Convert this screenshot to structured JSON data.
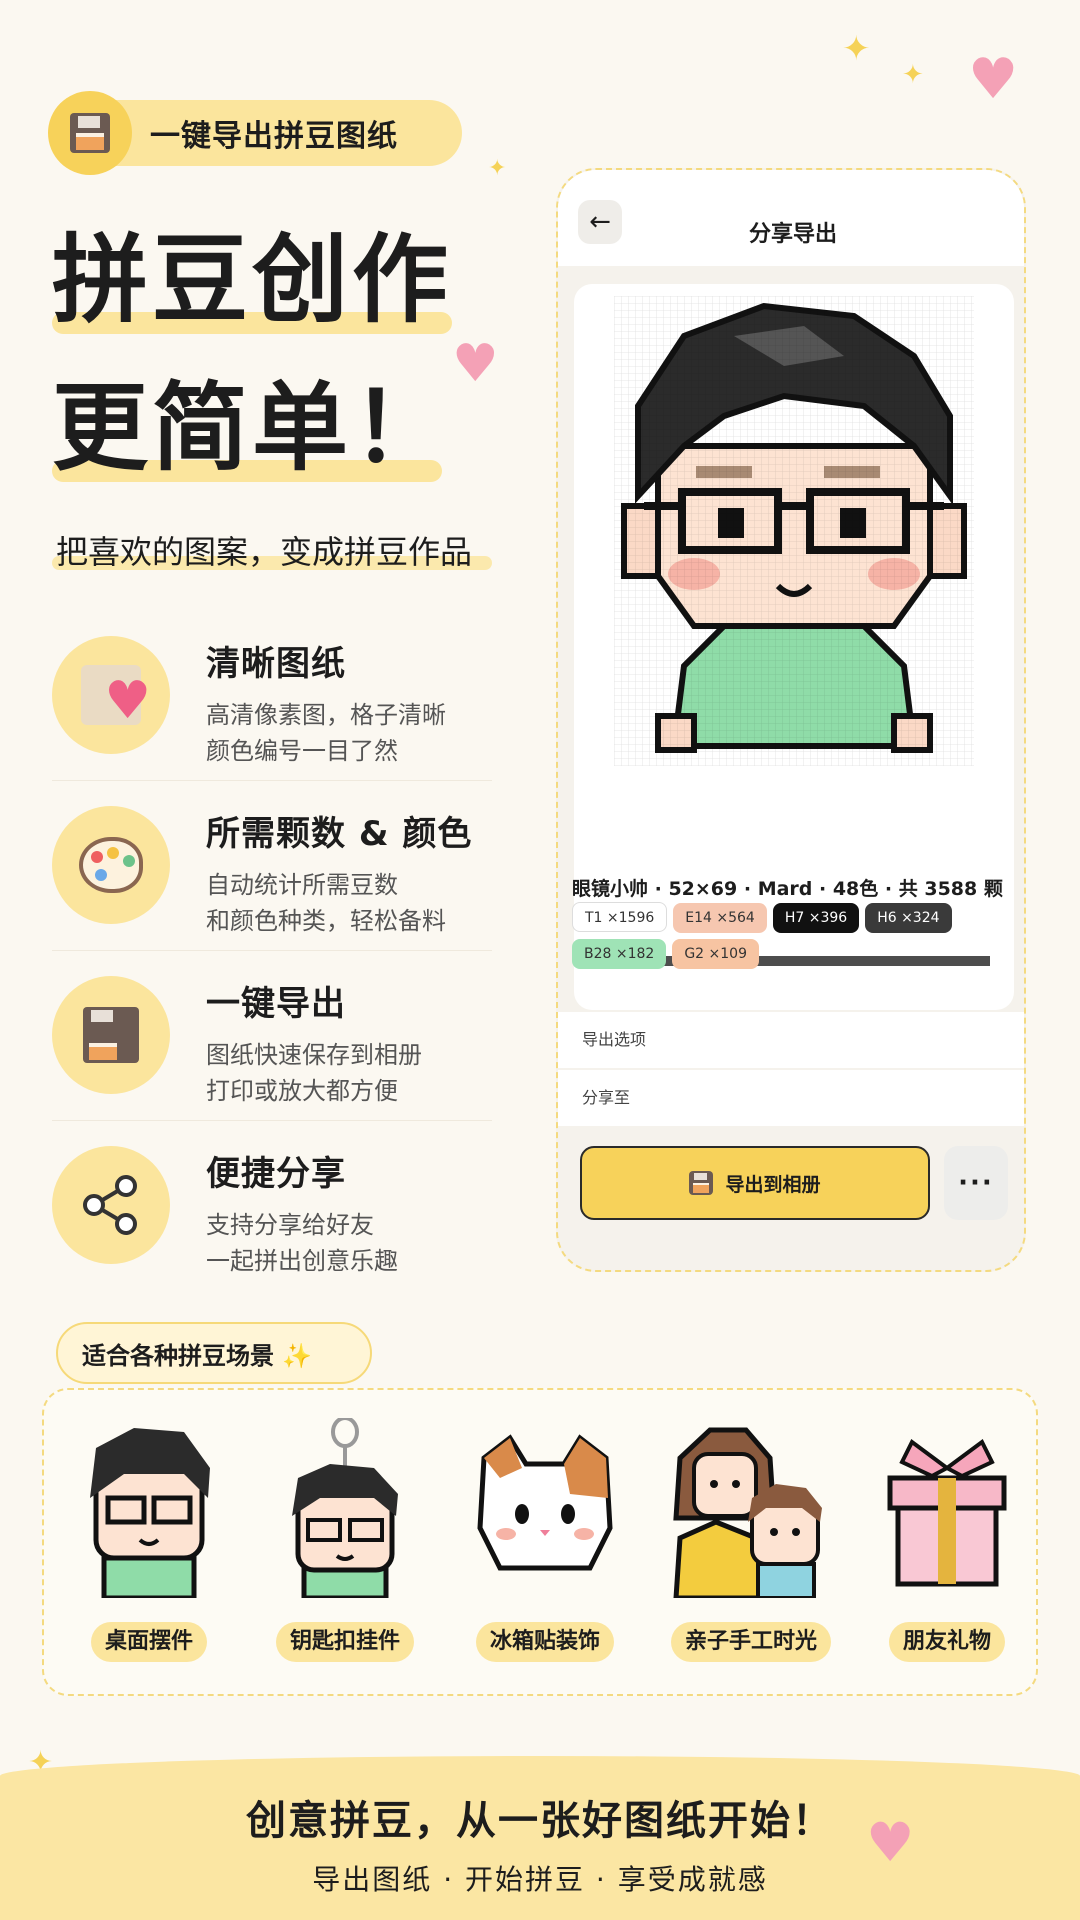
{
  "header": {
    "badge_label": "一键导出拼豆图纸",
    "icon": "floppy-disk-icon"
  },
  "hero": {
    "line1": "拼豆创作",
    "line2": "更简单！",
    "subtitle": "把喜欢的图案，变成拼豆作品"
  },
  "features": [
    {
      "title": "清晰图纸",
      "desc1": "高清像素图，格子清晰",
      "desc2": "颜色编号一目了然",
      "icon": "pixel-heart-paper-icon"
    },
    {
      "title": "所需颗数 & 颜色",
      "desc1": "自动统计所需豆数",
      "desc2": "和颜色种类，轻松备料",
      "icon": "palette-icon"
    },
    {
      "title": "一键导出",
      "desc1": "图纸快速保存到相册",
      "desc2": "打印或放大都方便",
      "icon": "floppy-disk-icon"
    },
    {
      "title": "便捷分享",
      "desc1": "支持分享给好友",
      "desc2": "一起拼出创意乐趣",
      "icon": "share-icon"
    }
  ],
  "phone": {
    "back_glyph": "←",
    "title": "分享导出",
    "meta": "眼镜小帅 · 52×69 · Mard · 48色 · 共 3588 颗",
    "chips": [
      {
        "label": "T1 ×1596",
        "bg": "#ffffff",
        "fg": "#333333"
      },
      {
        "label": "E14 ×564",
        "bg": "#f6c7b0",
        "fg": "#333333"
      },
      {
        "label": "H7 ×396",
        "bg": "#111111",
        "fg": "#ffffff"
      },
      {
        "label": "H6 ×324",
        "bg": "#3a3a3a",
        "fg": "#ffffff"
      },
      {
        "label": "B28 ×182",
        "bg": "#9fe3b6",
        "fg": "#333333"
      },
      {
        "label": "G2 ×109",
        "bg": "#f7c4a2",
        "fg": "#333333"
      }
    ],
    "export_options_label": "导出选项",
    "share_to_label": "分享至",
    "export_button": "导出到相册",
    "more_button": "···"
  },
  "scenarios": {
    "tag": "适合各种拼豆场景 ✨",
    "items": [
      {
        "label": "桌面摆件",
        "icon": "boy-avatar-icon"
      },
      {
        "label": "钥匙扣挂件",
        "icon": "keychain-boy-icon"
      },
      {
        "label": "冰箱贴装饰",
        "icon": "cat-icon"
      },
      {
        "label": "亲子手工时光",
        "icon": "mother-child-icon"
      },
      {
        "label": "朋友礼物",
        "icon": "gift-box-icon"
      }
    ]
  },
  "footer": {
    "title": "创意拼豆，从一张好图纸开始！",
    "subtitle": "导出图纸 · 开始拼豆 · 享受成就感"
  },
  "colors": {
    "accent": "#f7d25a",
    "soft": "#fbe59d",
    "heart": "#f4a1b6",
    "background": "#fbf8f1"
  }
}
